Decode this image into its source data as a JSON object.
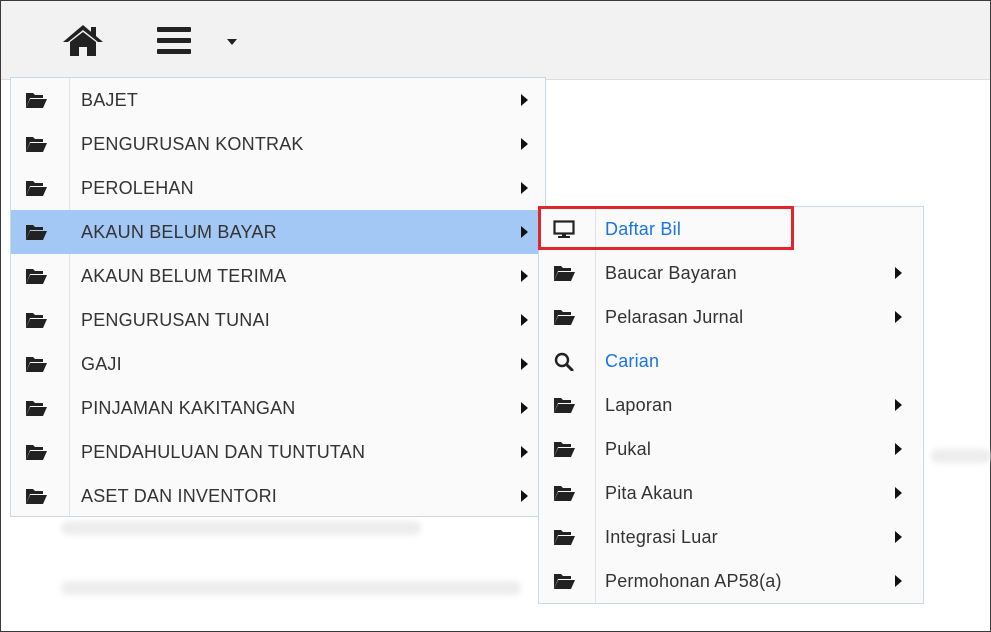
{
  "toolbar": {
    "home_icon": "home-icon",
    "menu_icon": "hamburger-menu-icon"
  },
  "main_menu": {
    "items": [
      {
        "label": "BAJET",
        "icon": "folder-open-icon",
        "has_submenu": true
      },
      {
        "label": "PENGURUSAN KONTRAK",
        "icon": "folder-open-icon",
        "has_submenu": true
      },
      {
        "label": "PEROLEHAN",
        "icon": "folder-open-icon",
        "has_submenu": true
      },
      {
        "label": "AKAUN BELUM BAYAR",
        "icon": "folder-open-icon",
        "has_submenu": true,
        "active": true
      },
      {
        "label": "AKAUN BELUM TERIMA",
        "icon": "folder-open-icon",
        "has_submenu": true
      },
      {
        "label": "PENGURUSAN TUNAI",
        "icon": "folder-open-icon",
        "has_submenu": true
      },
      {
        "label": "GAJI",
        "icon": "folder-open-icon",
        "has_submenu": true
      },
      {
        "label": "PINJAMAN KAKITANGAN",
        "icon": "folder-open-icon",
        "has_submenu": true
      },
      {
        "label": "PENDAHULUAN DAN TUNTUTAN",
        "icon": "folder-open-icon",
        "has_submenu": true
      },
      {
        "label": "ASET DAN INVENTORI",
        "icon": "folder-open-icon",
        "has_submenu": true
      }
    ]
  },
  "submenu": {
    "items": [
      {
        "label": "Daftar Bil",
        "icon": "monitor-icon",
        "has_submenu": false,
        "link": true,
        "highlighted": true
      },
      {
        "label": "Baucar Bayaran",
        "icon": "folder-open-icon",
        "has_submenu": true
      },
      {
        "label": "Pelarasan Jurnal",
        "icon": "folder-open-icon",
        "has_submenu": true
      },
      {
        "label": "Carian",
        "icon": "search-icon",
        "has_submenu": false,
        "link": true
      },
      {
        "label": "Laporan",
        "icon": "folder-open-icon",
        "has_submenu": true
      },
      {
        "label": "Pukal",
        "icon": "folder-open-icon",
        "has_submenu": true
      },
      {
        "label": "Pita Akaun",
        "icon": "folder-open-icon",
        "has_submenu": true
      },
      {
        "label": "Integrasi Luar",
        "icon": "folder-open-icon",
        "has_submenu": true
      },
      {
        "label": "Permohonan AP58(a)",
        "icon": "folder-open-icon",
        "has_submenu": true
      }
    ]
  },
  "colors": {
    "active_row": "#a3c8f5",
    "link_text": "#1a73e8",
    "highlight_border": "#e0262a"
  }
}
